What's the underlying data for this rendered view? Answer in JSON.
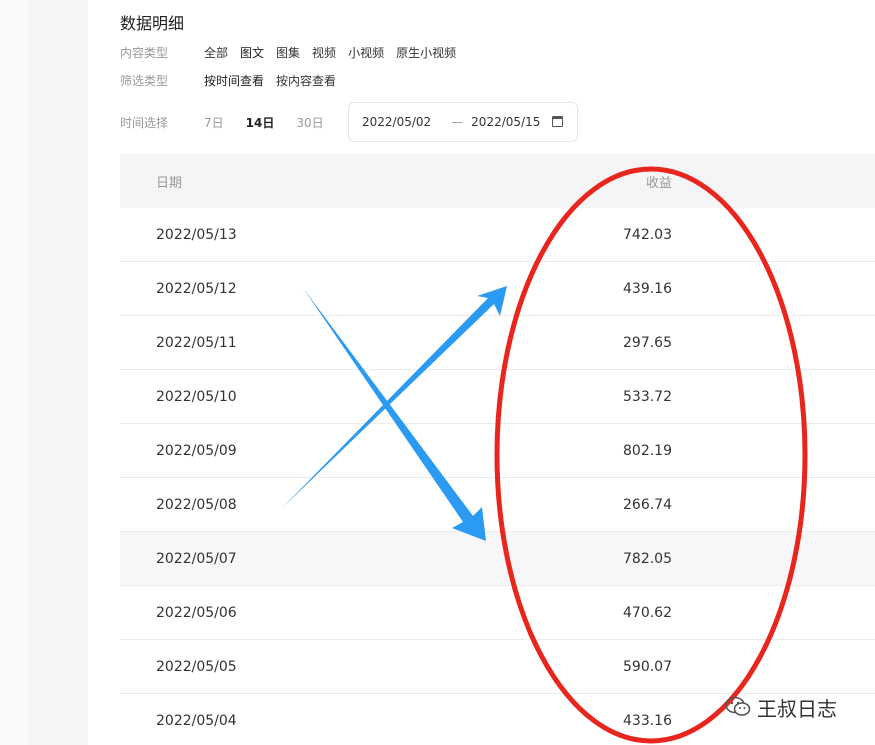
{
  "section": {
    "title": "数据明细"
  },
  "filters": {
    "content_type": {
      "label": "内容类型",
      "options": [
        "全部",
        "图文",
        "图集",
        "视频",
        "小视频",
        "原生小视频"
      ]
    },
    "screen_type": {
      "label": "筛选类型",
      "options": [
        "按时间查看",
        "按内容查看"
      ]
    },
    "time_select": {
      "label": "时间选择",
      "options": [
        "7日",
        "14日",
        "30日"
      ],
      "selected": "14日"
    },
    "date_range": {
      "start": "2022/05/02",
      "separator": "—",
      "end": "2022/05/15"
    }
  },
  "table": {
    "headers": {
      "date": "日期",
      "value": "收益"
    },
    "rows": [
      {
        "date": "2022/05/13",
        "value": "742.03"
      },
      {
        "date": "2022/05/12",
        "value": "439.16"
      },
      {
        "date": "2022/05/11",
        "value": "297.65"
      },
      {
        "date": "2022/05/10",
        "value": "533.72"
      },
      {
        "date": "2022/05/09",
        "value": "802.19"
      },
      {
        "date": "2022/05/08",
        "value": "266.74"
      },
      {
        "date": "2022/05/07",
        "value": "782.05"
      },
      {
        "date": "2022/05/06",
        "value": "470.62"
      },
      {
        "date": "2022/05/05",
        "value": "590.07"
      },
      {
        "date": "2022/05/04",
        "value": "433.16"
      }
    ]
  },
  "annotations": {
    "ellipse_color": "#e8261d",
    "arrow_color": "#2b9af3"
  },
  "watermark": {
    "text": "王叔日志",
    "icon": "wechat-icon"
  }
}
